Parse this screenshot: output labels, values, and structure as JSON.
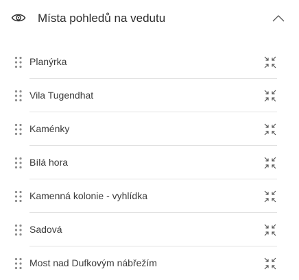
{
  "header": {
    "title": "Místa pohledů na vedutu",
    "visibility_icon": "eye-icon",
    "collapse_icon": "chevron-up-icon"
  },
  "items": [
    {
      "label": "Planýrka"
    },
    {
      "label": "Vila Tugendhat"
    },
    {
      "label": "Kaménky"
    },
    {
      "label": "Bílá hora"
    },
    {
      "label": "Kamenná kolonie - vyhlídka"
    },
    {
      "label": "Sadová"
    },
    {
      "label": "Most nad Dufkovým nábřežím"
    }
  ],
  "row_icons": {
    "drag": "drag-handle-icon",
    "zoom": "zoom-to-icon"
  },
  "colors": {
    "text": "#3a3a3a",
    "icon": "#6e6e6e",
    "divider": "#e1e1e1",
    "background": "#ffffff"
  }
}
